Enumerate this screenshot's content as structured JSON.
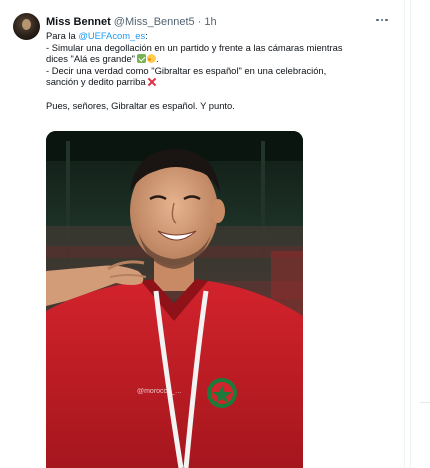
{
  "tweet": {
    "author": {
      "display_name": "Miss Bennet",
      "handle": "@Miss_Bennet5",
      "separator": "·",
      "time": "1h"
    },
    "text": {
      "intro_prefix": "Para la ",
      "mention": "@UEFAcom_es",
      "intro_suffix": ":",
      "line1": "- Simular una degollación en un partido y frente a las cámaras mientras",
      "line2": "dices \"Alá es grande\"",
      "line2_end": ".",
      "line3": "- Decir una verdad como \"Gibraltar es español\" en una celebración,",
      "line4": "sanción y dedito parriba",
      "closing": "Pues, señores, Gibraltar es español. Y punto."
    },
    "emoji": [
      "check-mark-emoji",
      "smiling-face-hearts-emoji",
      "cross-mark-emoji"
    ],
    "media": {
      "type": "video-still",
      "watermark": "@morocco_…"
    }
  },
  "colors": {
    "text": "#0f1419",
    "secondary": "#536471",
    "link": "#1d9bf0",
    "jersey_red": "#c8202a"
  }
}
